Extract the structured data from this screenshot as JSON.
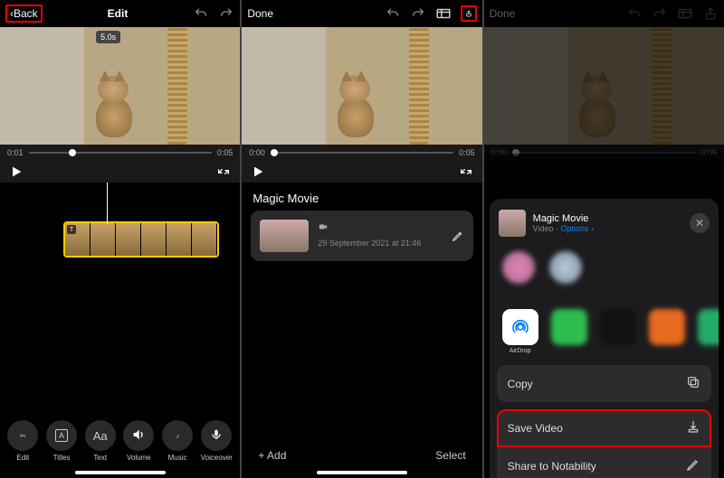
{
  "screen1": {
    "back": "Back",
    "title": "Edit",
    "clip_badge": "5.0s",
    "time_start": "0:01",
    "time_end": "0:05",
    "tools": {
      "edit": "Edit",
      "titles": "Titles",
      "text": "Text",
      "volume": "Volume",
      "music": "Music",
      "voiceover": "Voiceover"
    }
  },
  "screen2": {
    "done": "Done",
    "time_start": "0:00",
    "time_end": "0:05",
    "section": "Magic Movie",
    "card": {
      "date": "29 September 2021 at 21:46"
    },
    "add": "Add",
    "select": "Select"
  },
  "screen3": {
    "done": "Done",
    "time_start": "0:00",
    "time_end": "0:05",
    "share": {
      "title": "Magic Movie",
      "subtitle_prefix": "Video · ",
      "options": "Options",
      "airdrop": "AirDrop",
      "copy": "Copy",
      "save_video": "Save Video",
      "share_notability": "Share to Notability"
    }
  }
}
